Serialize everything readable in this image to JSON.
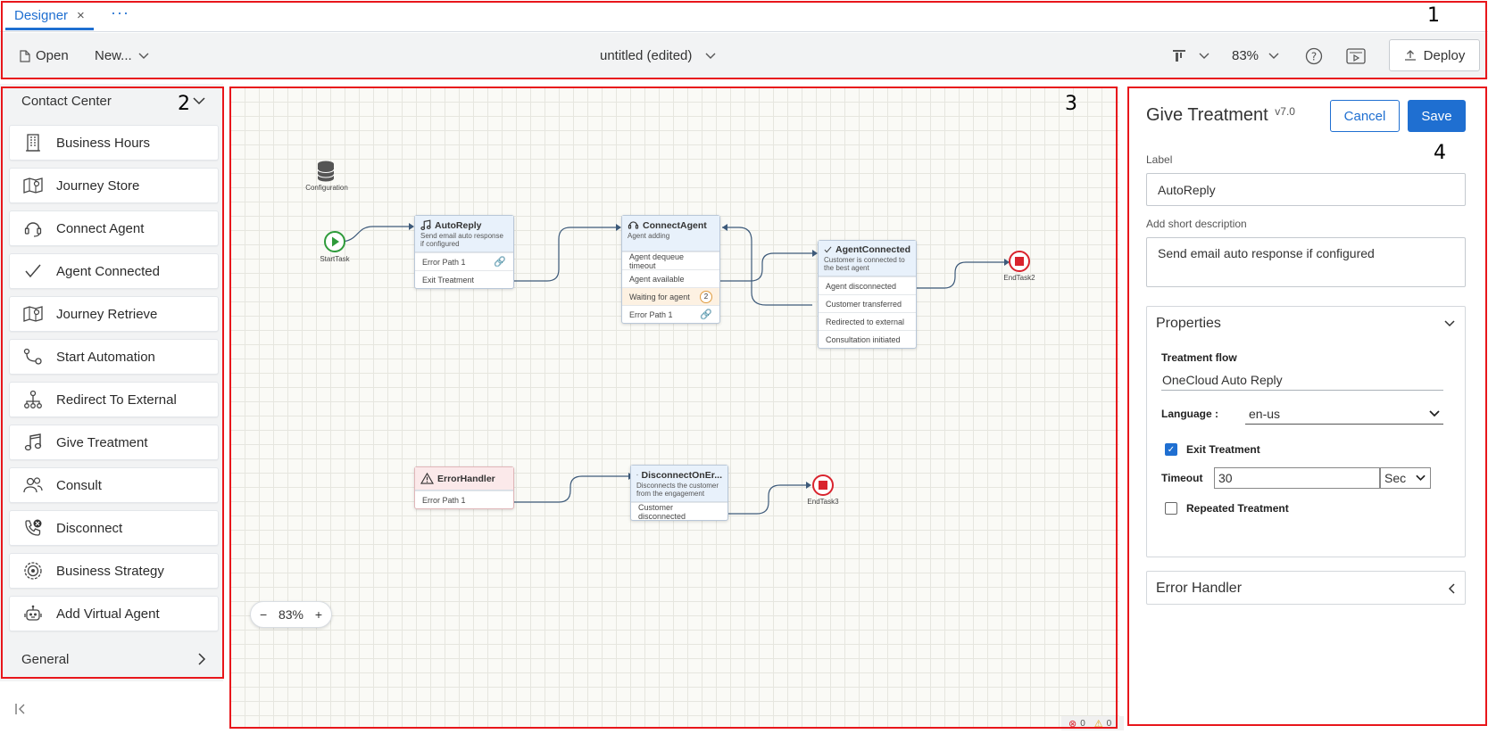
{
  "tab": {
    "label": "Designer",
    "close": "×",
    "more": "···"
  },
  "toolbar": {
    "open": "Open",
    "new": "New...",
    "flow_title": "untitled (edited)",
    "zoom": "83%",
    "deploy": "Deploy"
  },
  "palette": {
    "section": "Contact Center",
    "items": [
      {
        "label": "Business Hours",
        "icon": "building-icon"
      },
      {
        "label": "Journey Store",
        "icon": "map-pin-icon"
      },
      {
        "label": "Connect Agent",
        "icon": "headset-icon"
      },
      {
        "label": "Agent Connected",
        "icon": "checkmark-icon"
      },
      {
        "label": "Journey Retrieve",
        "icon": "map-pin-icon"
      },
      {
        "label": "Start Automation",
        "icon": "automation-icon"
      },
      {
        "label": "Redirect To External",
        "icon": "hierarchy-icon"
      },
      {
        "label": "Give Treatment",
        "icon": "music-note-icon"
      },
      {
        "label": "Consult",
        "icon": "people-icon"
      },
      {
        "label": "Disconnect",
        "icon": "phone-x-icon"
      },
      {
        "label": "Business Strategy",
        "icon": "target-icon"
      },
      {
        "label": "Add Virtual Agent",
        "icon": "robot-icon"
      }
    ],
    "general": "General"
  },
  "canvas": {
    "configuration": "Configuration",
    "start": "StartTask",
    "end2": "EndTask2",
    "end3": "EndTask3",
    "zoom": "83%",
    "zoom_minus": "−",
    "zoom_plus": "+",
    "errors": "0",
    "warnings": "0",
    "nodes": {
      "autoreply": {
        "title": "AutoReply",
        "desc": "Send email auto response if configured",
        "rows": [
          "Error Path 1",
          "Exit Treatment"
        ]
      },
      "connectagent": {
        "title": "ConnectAgent",
        "desc": "Agent adding",
        "rows": [
          "Agent dequeue timeout",
          "Agent available",
          "Waiting for agent",
          "Error Path 1"
        ],
        "badge": "2"
      },
      "agentconnected": {
        "title": "AgentConnected",
        "desc": "Customer is connected to the best agent",
        "rows": [
          "Agent disconnected",
          "Customer transferred",
          "Redirected to external",
          "Consultation initiated"
        ]
      },
      "errorhandler": {
        "title": "ErrorHandler",
        "rows": [
          "Error Path 1"
        ]
      },
      "disconnect": {
        "title": "DisconnectOnEr...",
        "desc": "Disconnects the customer from the engagement",
        "rows": [
          "Customer disconnected"
        ]
      }
    }
  },
  "properties": {
    "title": "Give Treatment",
    "version": "v7.0",
    "cancel": "Cancel",
    "save": "Save",
    "label_caption": "Label",
    "label_value": "AutoReply",
    "desc_caption": "Add short description",
    "desc_value": "Send email auto response if configured",
    "section_props": "Properties",
    "treatment_flow_caption": "Treatment flow",
    "treatment_flow_value": "OneCloud Auto Reply",
    "language_caption": "Language :",
    "language_value": "en-us",
    "exit_treatment": "Exit Treatment",
    "timeout_caption": "Timeout",
    "timeout_value": "30",
    "timeout_unit": "Sec",
    "repeated_treatment": "Repeated Treatment",
    "section_error": "Error Handler"
  },
  "markers": [
    "1",
    "2",
    "3",
    "4"
  ],
  "colors": {
    "accent": "#1f6fd1",
    "highlight": "#e8161b"
  }
}
